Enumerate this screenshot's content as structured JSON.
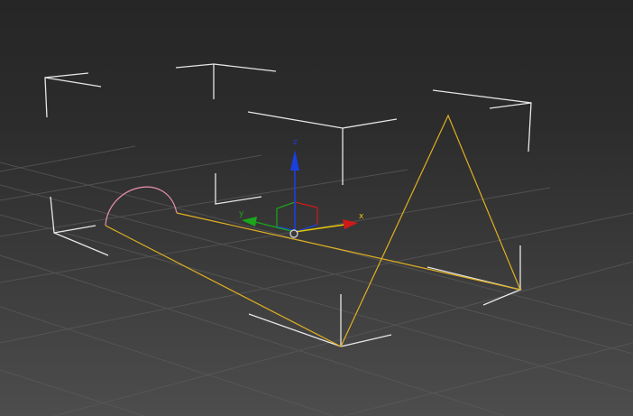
{
  "viewport": {
    "view": "perspective",
    "background_top": "#262626",
    "background_bottom": "#4d4d4d",
    "grid_color": "#5a5a5a",
    "bracket_color": "#e6e6e6",
    "spline_color": "#e0b020",
    "arc_color": "#e890b0",
    "selection": "selection-bracket-box"
  },
  "gizmo": {
    "type": "move-transform-gizmo",
    "x_label": "x",
    "y_label": "y",
    "z_label": "z",
    "x_color": "#e8c800",
    "y_color": "#1aa61a",
    "z_color": "#1a3fe0",
    "x_arrow_color": "#cc1a1a",
    "pivot_color": "#e0e0e0"
  }
}
